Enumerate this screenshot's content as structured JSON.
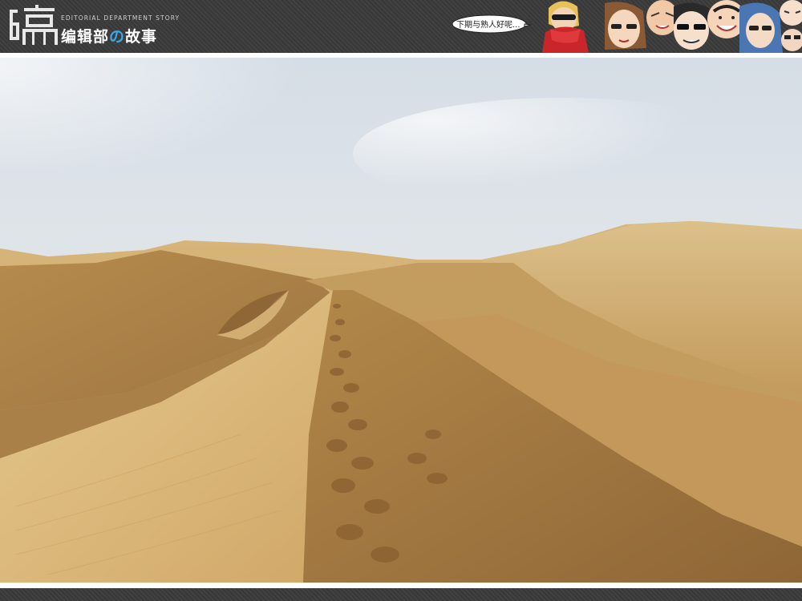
{
  "header": {
    "logo_glyph": "编",
    "subtitle": "EDITORIAL DEPARTMENT STORY",
    "title_part1": "编辑部",
    "title_no": "の",
    "title_part2": "故事",
    "speech": "下期与熟人好呢...",
    "logo_icon": "pen-logo-icon",
    "characters_icon": "cartoon-characters-icon"
  },
  "photo": {
    "subject": "desert-dunes-photo"
  },
  "colors": {
    "bar": "#3a3a3a",
    "accent": "#39a8e6",
    "sand_light": "#d8b677",
    "sand_dark": "#a57a3e",
    "sky": "#dfe5ea"
  }
}
